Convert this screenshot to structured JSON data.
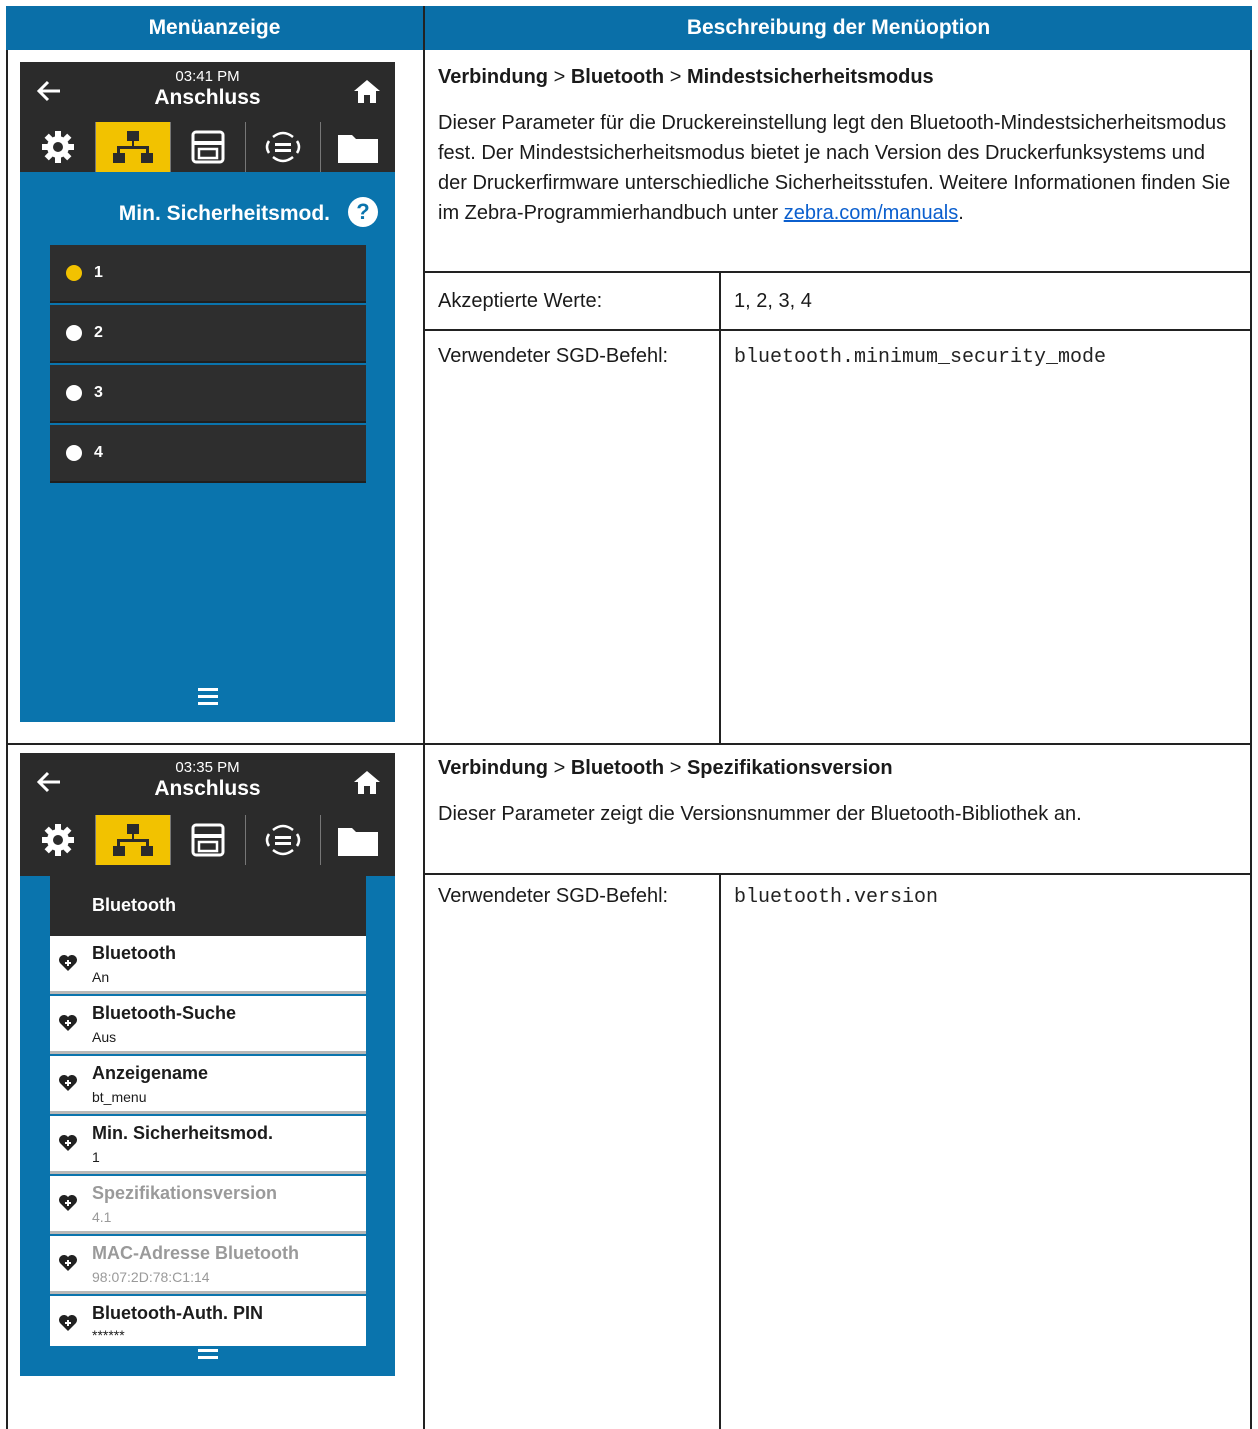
{
  "table": {
    "header_left": "Menüanzeige",
    "header_right": "Beschreibung der Menüoption"
  },
  "row1": {
    "screen": {
      "time": "03:41 PM",
      "title": "Anschluss",
      "subheader": "Min. Sicherheitsmod.",
      "options": [
        "1",
        "2",
        "3",
        "4"
      ],
      "selected_option": "1"
    },
    "breadcrumb": [
      "Verbindung",
      "Bluetooth",
      "Mindestsicherheitsmodus"
    ],
    "separator": ">",
    "desc_before_link": "Dieser Parameter für die Druckereinstellung legt den Bluetooth-Mindestsicherheitsmodus fest. Der Mindestsicherheitsmodus bietet je nach Version des Druckerfunksystems und der Druckerfirmware unterschiedliche Sicherheitsstufen. Weitere Informationen finden Sie im Zebra-Programmierhandbuch unter ",
    "link_text": "zebra.com/manuals",
    "desc_after_link": ".",
    "values_label": "Akzeptierte Werte:",
    "values": "1, 2, 3, 4",
    "sgd_label": "Verwendeter SGD-Befehl:",
    "sgd_command": "bluetooth.minimum_security_mode"
  },
  "row2": {
    "screen": {
      "time": "03:35 PM",
      "title": "Anschluss",
      "list_title": "Bluetooth",
      "items": [
        {
          "name": "Bluetooth",
          "value": "An"
        },
        {
          "name": "Bluetooth-Suche",
          "value": "Aus"
        },
        {
          "name": "Anzeigename",
          "value": "bt_menu"
        },
        {
          "name": "Min. Sicherheitsmod.",
          "value": "1"
        },
        {
          "name": "Spezifikationsversion",
          "value": "4.1"
        },
        {
          "name": "MAC-Adresse Bluetooth",
          "value": "98:07:2D:78:C1:14"
        },
        {
          "name": "Bluetooth-Auth. PIN",
          "value": "******"
        }
      ]
    },
    "breadcrumb": [
      "Verbindung",
      "Bluetooth",
      "Spezifikationsversion"
    ],
    "separator": ">",
    "description": "Dieser Parameter zeigt die Versionsnummer der Bluetooth-Bibliothek an.",
    "sgd_label": "Verwendeter SGD-Befehl:",
    "sgd_command": "bluetooth.version"
  }
}
